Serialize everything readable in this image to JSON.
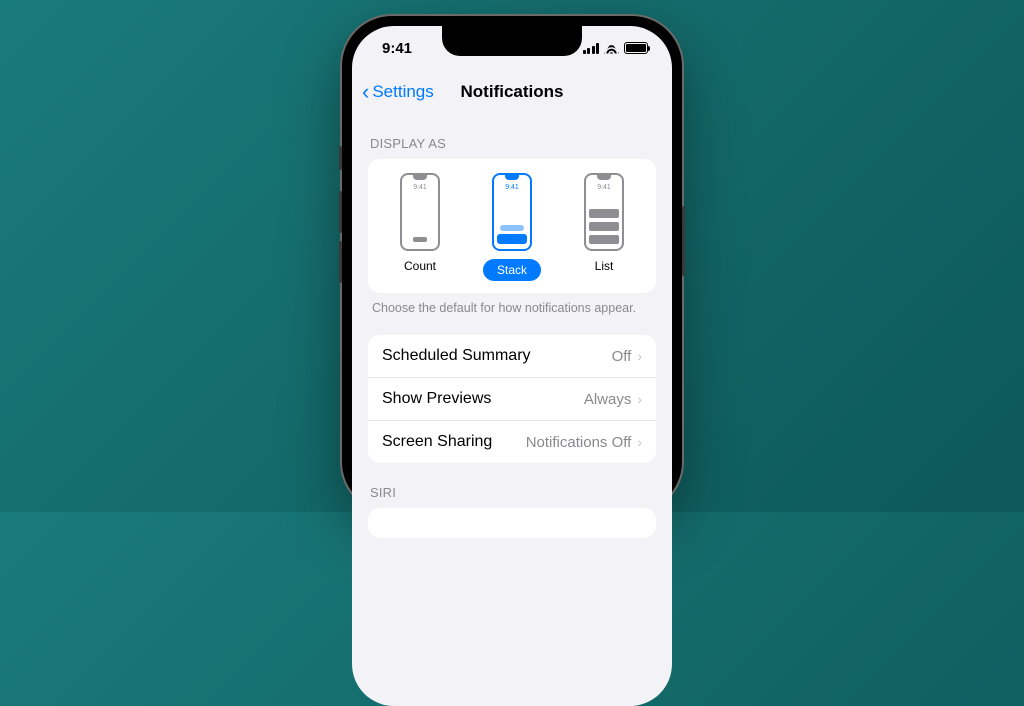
{
  "status": {
    "time": "9:41"
  },
  "nav": {
    "back": "Settings",
    "title": "Notifications"
  },
  "displayAs": {
    "header": "DISPLAY AS",
    "miniTime": "9:41",
    "options": {
      "count": "Count",
      "stack": "Stack",
      "list": "List"
    },
    "footer": "Choose the default for how notifications appear."
  },
  "rows": {
    "scheduled": {
      "label": "Scheduled Summary",
      "value": "Off"
    },
    "previews": {
      "label": "Show Previews",
      "value": "Always"
    },
    "sharing": {
      "label": "Screen Sharing",
      "value": "Notifications Off"
    }
  },
  "siri": {
    "header": "SIRI"
  }
}
